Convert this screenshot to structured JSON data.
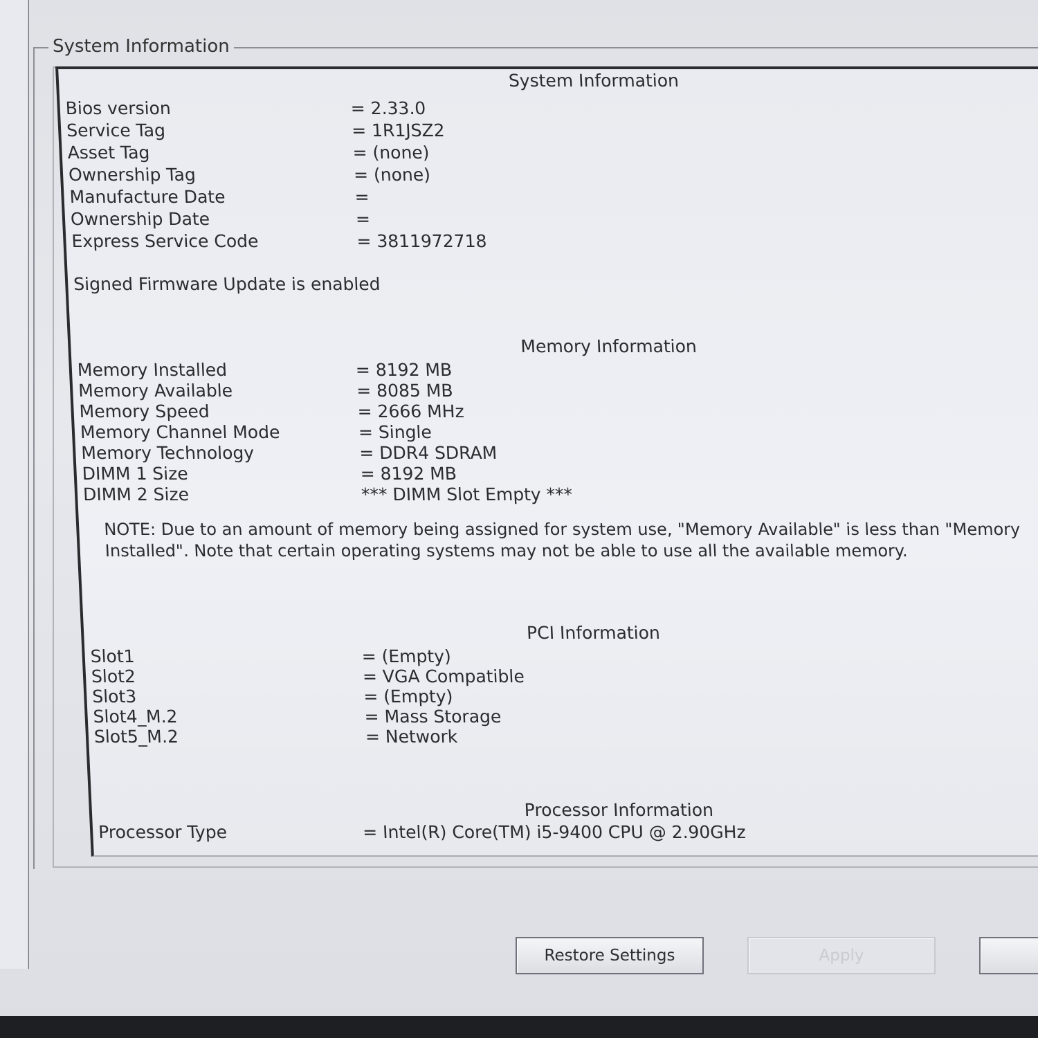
{
  "group_title": "System Information",
  "sections": {
    "system": {
      "title": "System Information",
      "rows": [
        {
          "label": "Bios version",
          "value": "= 2.33.0"
        },
        {
          "label": "Service Tag",
          "value": "= 1R1JSZ2"
        },
        {
          "label": "Asset Tag",
          "value": "= (none)"
        },
        {
          "label": "Ownership Tag",
          "value": "= (none)"
        },
        {
          "label": "Manufacture Date",
          "value": "="
        },
        {
          "label": "Ownership Date",
          "value": "="
        },
        {
          "label": "Express Service Code",
          "value": "= 3811972718"
        }
      ],
      "firmware_note": "Signed Firmware Update is enabled"
    },
    "memory": {
      "title": "Memory Information",
      "rows": [
        {
          "label": "Memory Installed",
          "value": "= 8192 MB"
        },
        {
          "label": "Memory Available",
          "value": "= 8085 MB"
        },
        {
          "label": "Memory Speed",
          "value": "= 2666 MHz"
        },
        {
          "label": "Memory Channel Mode",
          "value": "= Single"
        },
        {
          "label": "Memory Technology",
          "value": "= DDR4 SDRAM"
        },
        {
          "label": "DIMM 1 Size",
          "value": "= 8192 MB"
        },
        {
          "label": "DIMM 2 Size",
          "value": "*** DIMM Slot Empty ***"
        }
      ],
      "note": "NOTE: Due to an amount of memory being assigned for system use, \"Memory Available\" is less than \"Memory Installed\". Note that certain operating systems may not be able to use all the available memory."
    },
    "pci": {
      "title": "PCI Information",
      "rows": [
        {
          "label": "Slot1",
          "value": "= (Empty)"
        },
        {
          "label": "Slot2",
          "value": "= VGA Compatible"
        },
        {
          "label": "Slot3",
          "value": "= (Empty)"
        },
        {
          "label": "Slot4_M.2",
          "value": "= Mass Storage"
        },
        {
          "label": "Slot5_M.2",
          "value": "= Network"
        }
      ]
    },
    "processor": {
      "title": "Processor Information",
      "rows": [
        {
          "label": "Processor Type",
          "value": "= Intel(R) Core(TM) i5-9400 CPU @ 2.90GHz"
        }
      ]
    }
  },
  "buttons": {
    "restore": "Restore Settings",
    "apply": "Apply",
    "exit": ""
  }
}
